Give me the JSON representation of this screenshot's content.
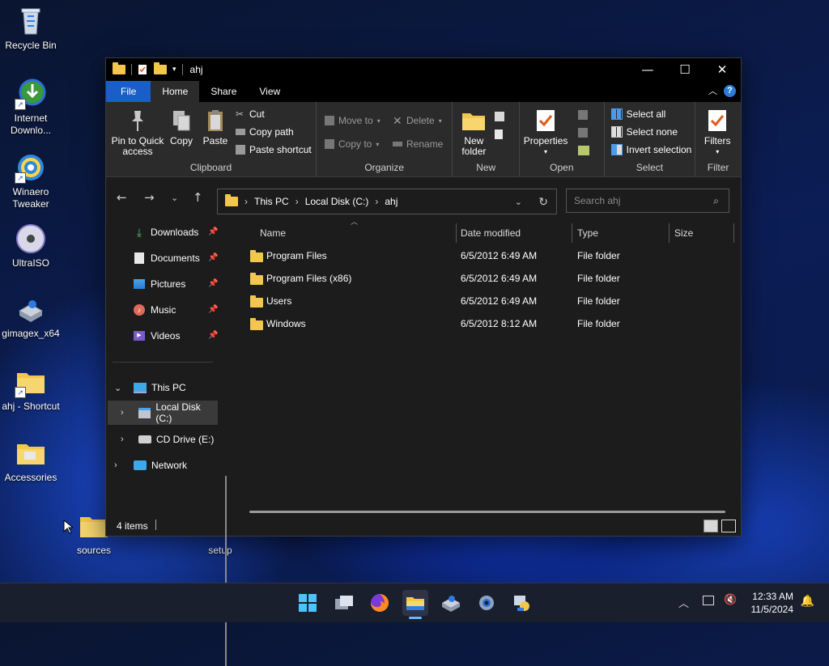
{
  "desktop": {
    "icons": [
      {
        "label": "Recycle Bin"
      },
      {
        "label": "Internet Downlo..."
      },
      {
        "label": "Winaero Tweaker"
      },
      {
        "label": "UltraISO"
      },
      {
        "label": "gimagex_x64"
      },
      {
        "label": "ahj - Shortcut"
      },
      {
        "label": "Accessories"
      },
      {
        "label": "sources"
      },
      {
        "label": "setup"
      }
    ]
  },
  "window": {
    "title": "ahj",
    "controls": {
      "minimize": "—",
      "maximize": "☐",
      "close": "✕"
    },
    "tabs": [
      "File",
      "Home",
      "Share",
      "View"
    ],
    "ribbon": {
      "clipboard": {
        "label": "Clipboard",
        "pin_to_quick_access": "Pin to Quick access",
        "copy": "Copy",
        "paste": "Paste",
        "cut": "Cut",
        "copy_path": "Copy path",
        "paste_shortcut": "Paste shortcut"
      },
      "organize": {
        "label": "Organize",
        "move_to": "Move to",
        "copy_to": "Copy to",
        "delete": "Delete",
        "rename": "Rename"
      },
      "new": {
        "label": "New",
        "new_folder": "New folder"
      },
      "open": {
        "label": "Open",
        "properties": "Properties"
      },
      "select": {
        "label": "Select",
        "select_all": "Select all",
        "select_none": "Select none",
        "invert_selection": "Invert selection"
      },
      "filter": {
        "label": "Filter",
        "filters": "Filters"
      }
    },
    "address": {
      "crumbs": [
        "This PC",
        "Local Disk (C:)",
        "ahj"
      ],
      "search_placeholder": "Search ahj"
    },
    "nav": {
      "quick": [
        {
          "label": "Downloads",
          "icon": "download-icon"
        },
        {
          "label": "Documents",
          "icon": "documents-icon"
        },
        {
          "label": "Pictures",
          "icon": "pictures-icon"
        },
        {
          "label": "Music",
          "icon": "music-icon"
        },
        {
          "label": "Videos",
          "icon": "videos-icon"
        }
      ],
      "this_pc": "This PC",
      "local_disk": "Local Disk (C:)",
      "cd_drive": "CD Drive (E:)",
      "network": "Network"
    },
    "columns": {
      "name": "Name",
      "date": "Date modified",
      "type": "Type",
      "size": "Size"
    },
    "files": [
      {
        "name": "Program Files",
        "date": "6/5/2012 6:49 AM",
        "type": "File folder"
      },
      {
        "name": "Program Files (x86)",
        "date": "6/5/2012 6:49 AM",
        "type": "File folder"
      },
      {
        "name": "Users",
        "date": "6/5/2012 6:49 AM",
        "type": "File folder"
      },
      {
        "name": "Windows",
        "date": "6/5/2012 8:12 AM",
        "type": "File folder"
      }
    ],
    "status": {
      "items": "4 items"
    }
  },
  "taskbar": {
    "time": "12:33 AM",
    "date": "11/5/2024"
  },
  "colors": {
    "accent": "#1a5fc7",
    "folder": "#f2c74b",
    "window_bg": "#1c1c1c",
    "ribbon_bg": "#2b2b2b"
  }
}
